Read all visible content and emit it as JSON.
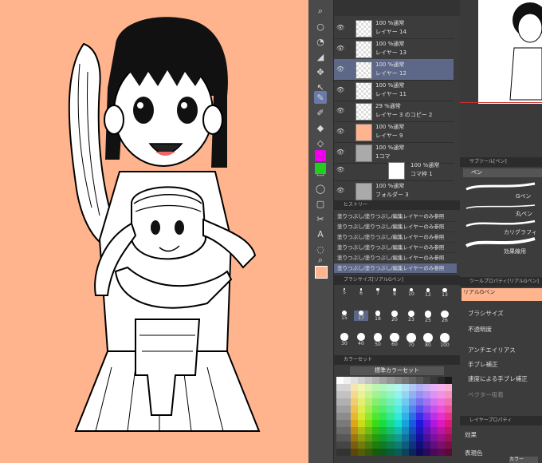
{
  "layers": [
    {
      "blend": "100 %通常",
      "name": "レイヤー 14"
    },
    {
      "blend": "100 %通常",
      "name": "レイヤー 13"
    },
    {
      "blend": "100 %通常",
      "name": "レイヤー 12",
      "selected": true
    },
    {
      "blend": "100 %通常",
      "name": "レイヤー 11"
    },
    {
      "blend": "29 %通常",
      "name": "レイヤー 3 のコピー 2"
    },
    {
      "blend": "100 %通常",
      "name": "レイヤー 9"
    },
    {
      "blend": "100 %通常",
      "name": "1コマ"
    },
    {
      "blend": "100 %通常",
      "name": "コマ枠 1"
    },
    {
      "blend": "100 %通常",
      "name": "フォルダー 3"
    }
  ],
  "history": {
    "title": "ヒストリー",
    "items": [
      "塗りつぶし/塗りつぶし/編集レイヤーのみ参照",
      "塗りつぶし/塗りつぶし/編集レイヤーのみ参照",
      "塗りつぶし/塗りつぶし/編集レイヤーのみ参照",
      "塗りつぶし/塗りつぶし/編集レイヤーのみ参照",
      "塗りつぶし/塗りつぶし/編集レイヤーのみ参照",
      "塗りつぶし/塗りつぶし/編集レイヤーのみ参照",
      "塗りつぶし/塗りつぶし/編集レイヤーのみ参照"
    ]
  },
  "brush_size": {
    "title": "ブラシサイズ[リアルGペン]",
    "sizes": [
      "5",
      "6",
      "7",
      "8",
      "10",
      "12",
      "13",
      "15",
      "17",
      "18",
      "20",
      "23",
      "25",
      "26",
      "30",
      "40",
      "50",
      "60",
      "70",
      "80",
      "100"
    ]
  },
  "color_set": {
    "title": "カラーセット",
    "selected": "標準カラーセット"
  },
  "sub_tool": {
    "title": "サブツール[ペン]",
    "group": "ペン",
    "items": [
      "Gペン",
      "丸ペン",
      "カリグラフィ",
      "効果線用"
    ]
  },
  "tool_property": {
    "title": "ツールプロパティ[リアルGペン]",
    "tool_name": "リアルGペン",
    "rows": [
      "ブラシサイズ",
      "不透明度",
      "アンチエイリアス",
      "手ブレ補正",
      "速度による手ブレ補正",
      "ベクター吸着"
    ]
  },
  "layer_property": {
    "title": "レイヤープロパティ",
    "rows": [
      "効果",
      "表現色"
    ],
    "button": "カラー"
  },
  "colors": {
    "canvas_bg": "#ffb48e",
    "selection": "#5d6787",
    "accent": "#6a7aa8"
  }
}
